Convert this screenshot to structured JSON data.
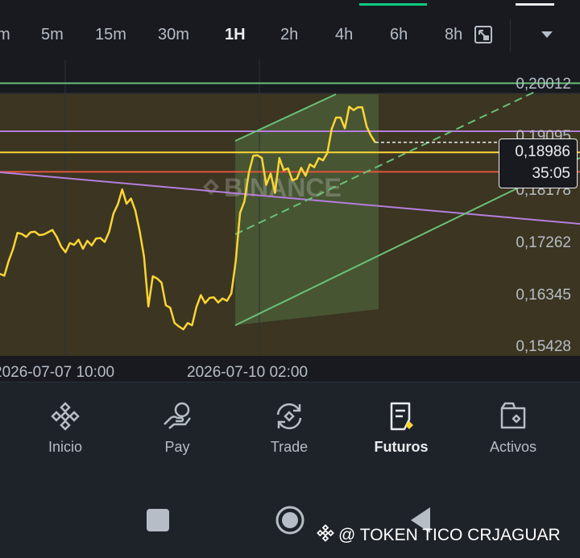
{
  "timeframes": [
    {
      "label": "m",
      "active": false
    },
    {
      "label": "5m",
      "active": false
    },
    {
      "label": "15m",
      "active": false
    },
    {
      "label": "30m",
      "active": false
    },
    {
      "label": "1H",
      "active": true
    },
    {
      "label": "2h",
      "active": false
    },
    {
      "label": "4h",
      "active": false
    },
    {
      "label": "6h",
      "active": false
    },
    {
      "label": "8h",
      "active": false
    }
  ],
  "chart": {
    "price_labels": [
      "0,20012",
      "0,19095",
      "0,18178",
      "0,17262",
      "0,16345",
      "0,15428"
    ],
    "date_labels": [
      "2026-07-07 10:00",
      "2026-07-10 02:00"
    ],
    "current_price": "0,18986",
    "countdown": "35:05",
    "watermark_text": "BINANCE"
  },
  "chart_data": {
    "type": "line",
    "ylim": [
      0.1543,
      0.2045
    ],
    "yticks": [
      0.20012,
      0.19095,
      0.18178,
      0.17262,
      0.16345,
      0.15428
    ],
    "x_labels": [
      "2026-07-07 10:00",
      "2026-07-10 02:00"
    ],
    "last_price": 0.18986,
    "series": [
      {
        "values": [
          0.1668,
          0.1665,
          0.1691,
          0.1712,
          0.174,
          0.1738,
          0.1733,
          0.1741,
          0.1742,
          0.1736,
          0.1737,
          0.1741,
          0.1745,
          0.1733,
          0.1716,
          0.1706,
          0.1722,
          0.1719,
          0.1728,
          0.1712,
          0.1726,
          0.1718,
          0.173,
          0.1731,
          0.1724,
          0.1742,
          0.1774,
          0.179,
          0.1816,
          0.1791,
          0.18,
          0.1779,
          0.1743,
          0.1698,
          0.1611,
          0.1664,
          0.166,
          0.1653,
          0.1613,
          0.1609,
          0.1582,
          0.1576,
          0.1571,
          0.1582,
          0.1578,
          0.161,
          0.1631,
          0.1617,
          0.1626,
          0.1627,
          0.1618,
          0.1625,
          0.1621,
          0.1634,
          0.169,
          0.1775,
          0.1795,
          0.1845,
          0.1875,
          0.1876,
          0.1871,
          0.1824,
          0.1844,
          0.181,
          0.1871,
          0.185,
          0.1853,
          0.1832,
          0.1835,
          0.1854,
          0.184,
          0.186,
          0.1855,
          0.1871,
          0.1867,
          0.188,
          0.1922,
          0.1942,
          0.1942,
          0.1923,
          0.1961,
          0.1955,
          0.196,
          0.196,
          0.1926,
          0.191,
          0.1898
        ]
      }
    ],
    "horizontal_lines": [
      {
        "value": 0.2002,
        "color": "#6ac07a"
      },
      {
        "value": 0.1918,
        "color": "#b57edc"
      },
      {
        "value": 0.1881,
        "color": "#fcd535"
      },
      {
        "value": 0.1847,
        "color": "#e0553d"
      }
    ],
    "grid": true
  },
  "nav": {
    "items": [
      {
        "label": "Inicio",
        "icon": "binance-logo-icon",
        "active": false
      },
      {
        "label": "Pay",
        "icon": "pay-hand-icon",
        "active": false
      },
      {
        "label": "Trade",
        "icon": "trade-cycle-icon",
        "active": false
      },
      {
        "label": "Futuros",
        "icon": "futures-doc-icon",
        "active": true
      },
      {
        "label": "Activos",
        "icon": "wallet-icon",
        "active": false
      }
    ]
  },
  "watermark_caption": "@ TOKEN TICO CRJAGUAR",
  "colors": {
    "background": "#181a20",
    "panel": "#1e2329",
    "accent_yellow": "#fcd535",
    "green": "#6ac07a",
    "purple": "#b57edc",
    "red": "#e0553d",
    "text_muted": "#b7bdc6"
  }
}
